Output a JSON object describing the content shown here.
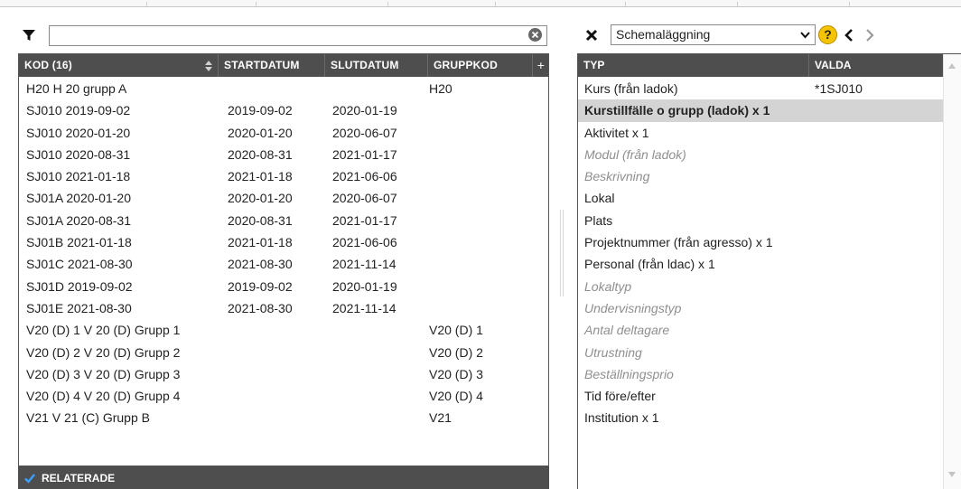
{
  "filter": {
    "value": "",
    "placeholder": ""
  },
  "left_table": {
    "headers": {
      "kod": "KOD (16)",
      "startdatum": "STARTDATUM",
      "slutdatum": "SLUTDATUM",
      "gruppkod": "GRUPPKOD",
      "add": "+"
    },
    "rows": [
      {
        "kod": "H20 H 20 grupp A",
        "start": "",
        "slut": "",
        "grupp": "H20"
      },
      {
        "kod": "SJ010 2019-09-02",
        "start": "2019-09-02",
        "slut": "2020-01-19",
        "grupp": ""
      },
      {
        "kod": "SJ010 2020-01-20",
        "start": "2020-01-20",
        "slut": "2020-06-07",
        "grupp": ""
      },
      {
        "kod": "SJ010 2020-08-31",
        "start": "2020-08-31",
        "slut": "2021-01-17",
        "grupp": ""
      },
      {
        "kod": "SJ010 2021-01-18",
        "start": "2021-01-18",
        "slut": "2021-06-06",
        "grupp": ""
      },
      {
        "kod": "SJ01A 2020-01-20",
        "start": "2020-01-20",
        "slut": "2020-06-07",
        "grupp": ""
      },
      {
        "kod": "SJ01A 2020-08-31",
        "start": "2020-08-31",
        "slut": "2021-01-17",
        "grupp": ""
      },
      {
        "kod": "SJ01B 2021-01-18",
        "start": "2021-01-18",
        "slut": "2021-06-06",
        "grupp": ""
      },
      {
        "kod": "SJ01C 2021-08-30",
        "start": "2021-08-30",
        "slut": "2021-11-14",
        "grupp": ""
      },
      {
        "kod": "SJ01D 2019-09-02",
        "start": "2019-09-02",
        "slut": "2020-01-19",
        "grupp": ""
      },
      {
        "kod": "SJ01E 2021-08-30",
        "start": "2021-08-30",
        "slut": "2021-11-14",
        "grupp": ""
      },
      {
        "kod": "V20 (D) 1 V 20 (D) Grupp 1",
        "start": "",
        "slut": "",
        "grupp": "V20 (D) 1"
      },
      {
        "kod": "V20 (D) 2 V 20 (D) Grupp 2",
        "start": "",
        "slut": "",
        "grupp": "V20 (D) 2"
      },
      {
        "kod": "V20 (D) 3 V 20 (D) Grupp 3",
        "start": "",
        "slut": "",
        "grupp": "V20 (D) 3"
      },
      {
        "kod": "V20 (D) 4 V 20 (D) Grupp 4",
        "start": "",
        "slut": "",
        "grupp": "V20 (D) 4"
      },
      {
        "kod": "V21 V 21 (C) Grupp B",
        "start": "",
        "slut": "",
        "grupp": "V21"
      }
    ]
  },
  "related": {
    "label": "RELATERADE",
    "checked": true
  },
  "right_toolbar": {
    "select_value": "Schemaläggning",
    "help_label": "?",
    "accent_color": "#f5c400"
  },
  "right_table": {
    "headers": {
      "typ": "TYP",
      "valda": "VALDA"
    },
    "rows": [
      {
        "typ": "Kurs (från ladok)",
        "valda": "*1SJ010",
        "state": "normal"
      },
      {
        "typ": "Kurstillfälle o grupp (ladok) x 1",
        "valda": "",
        "state": "selected"
      },
      {
        "typ": "Aktivitet x 1",
        "valda": "",
        "state": "normal"
      },
      {
        "typ": "Modul (från ladok)",
        "valda": "",
        "state": "dim"
      },
      {
        "typ": "Beskrivning",
        "valda": "",
        "state": "dim"
      },
      {
        "typ": "Lokal",
        "valda": "",
        "state": "normal"
      },
      {
        "typ": "Plats",
        "valda": "",
        "state": "normal"
      },
      {
        "typ": "Projektnummer (från agresso) x 1",
        "valda": "",
        "state": "normal"
      },
      {
        "typ": "Personal (från ldac) x 1",
        "valda": "",
        "state": "normal"
      },
      {
        "typ": "Lokaltyp",
        "valda": "",
        "state": "dim"
      },
      {
        "typ": "Undervisningstyp",
        "valda": "",
        "state": "dim"
      },
      {
        "typ": "Antal deltagare",
        "valda": "",
        "state": "dim"
      },
      {
        "typ": "Utrustning",
        "valda": "",
        "state": "dim"
      },
      {
        "typ": "Beställningsprio",
        "valda": "",
        "state": "dim"
      },
      {
        "typ": "Tid före/efter",
        "valda": "",
        "state": "normal"
      },
      {
        "typ": "Institution x 1",
        "valda": "",
        "state": "normal"
      }
    ]
  },
  "icons": {
    "filter": "filter-icon",
    "clear": "clear-circle-icon",
    "close": "close-x-icon",
    "help": "help-icon",
    "prev": "chevron-left-icon",
    "next": "chevron-right-icon",
    "checkbox": "checkmark-icon",
    "sort": "sort-icon"
  }
}
